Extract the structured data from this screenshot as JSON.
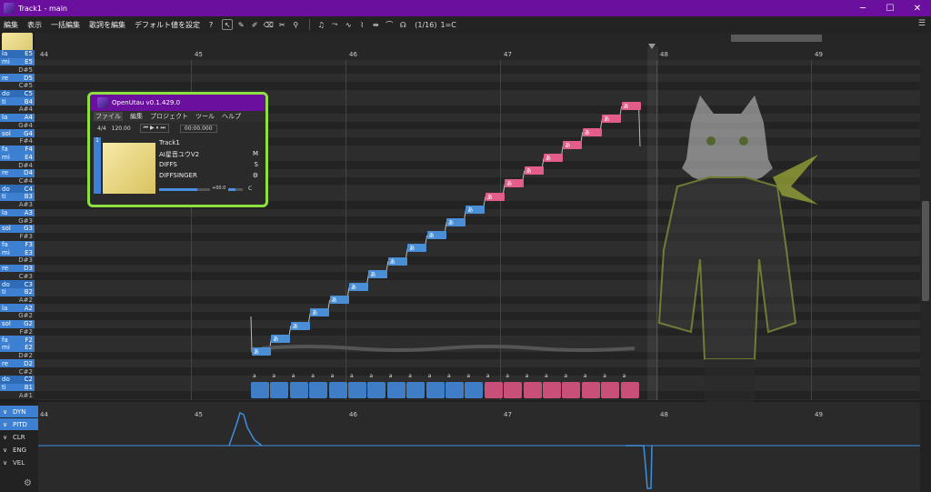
{
  "window": {
    "title": "Track1 - main",
    "minimize": "─",
    "maximize": "☐",
    "close": "✕"
  },
  "menu": [
    "編集",
    "表示",
    "一括編集",
    "歌詞を編集",
    "デフォルト値を設定",
    "?"
  ],
  "toolbar": {
    "tools": [
      "pointer-tool",
      "pen-tool",
      "pen-plus-tool",
      "eraser-tool",
      "knife-tool",
      "brush-tool"
    ],
    "toggles": [
      "note-toggle",
      "pitch-toggle",
      "vibrato-toggle",
      "portamento-toggle",
      "snap-toggle",
      "curve-toggle",
      "voice-toggle"
    ],
    "snap_label": "(1/16)",
    "key_label": "1=C"
  },
  "ruler": {
    "bars": [
      "44",
      "45",
      "46",
      "47",
      "48",
      "49"
    ]
  },
  "piano_keys": [
    {
      "solf": "la",
      "name": "E5",
      "type": "whitealt"
    },
    {
      "solf": "mi",
      "name": "E5",
      "type": "white"
    },
    {
      "solf": "",
      "name": "D#5",
      "type": "black"
    },
    {
      "solf": "re",
      "name": "D5",
      "type": "white"
    },
    {
      "solf": "",
      "name": "C#5",
      "type": "black"
    },
    {
      "solf": "do",
      "name": "C5",
      "type": "whitealt"
    },
    {
      "solf": "ti",
      "name": "B4",
      "type": "white"
    },
    {
      "solf": "",
      "name": "A#4",
      "type": "black"
    },
    {
      "solf": "la",
      "name": "A4",
      "type": "white"
    },
    {
      "solf": "",
      "name": "G#4",
      "type": "black"
    },
    {
      "solf": "sol",
      "name": "G4",
      "type": "white"
    },
    {
      "solf": "",
      "name": "F#4",
      "type": "black"
    },
    {
      "solf": "fa",
      "name": "F4",
      "type": "white"
    },
    {
      "solf": "mi",
      "name": "E4",
      "type": "white"
    },
    {
      "solf": "",
      "name": "D#4",
      "type": "black"
    },
    {
      "solf": "re",
      "name": "D4",
      "type": "white"
    },
    {
      "solf": "",
      "name": "C#4",
      "type": "black"
    },
    {
      "solf": "do",
      "name": "C4",
      "type": "whitealt"
    },
    {
      "solf": "ti",
      "name": "B3",
      "type": "white"
    },
    {
      "solf": "",
      "name": "A#3",
      "type": "black"
    },
    {
      "solf": "la",
      "name": "A3",
      "type": "white"
    },
    {
      "solf": "",
      "name": "G#3",
      "type": "black"
    },
    {
      "solf": "sol",
      "name": "G3",
      "type": "white"
    },
    {
      "solf": "",
      "name": "F#3",
      "type": "black"
    },
    {
      "solf": "fa",
      "name": "F3",
      "type": "white"
    },
    {
      "solf": "mi",
      "name": "E3",
      "type": "white"
    },
    {
      "solf": "",
      "name": "D#3",
      "type": "black"
    },
    {
      "solf": "re",
      "name": "D3",
      "type": "white"
    },
    {
      "solf": "",
      "name": "C#3",
      "type": "black"
    },
    {
      "solf": "do",
      "name": "C3",
      "type": "whitealt"
    },
    {
      "solf": "ti",
      "name": "B2",
      "type": "white"
    },
    {
      "solf": "",
      "name": "A#2",
      "type": "black"
    },
    {
      "solf": "la",
      "name": "A2",
      "type": "white"
    },
    {
      "solf": "",
      "name": "G#2",
      "type": "black"
    },
    {
      "solf": "sol",
      "name": "G2",
      "type": "white"
    },
    {
      "solf": "",
      "name": "F#2",
      "type": "black"
    },
    {
      "solf": "fa",
      "name": "F2",
      "type": "white"
    },
    {
      "solf": "mi",
      "name": "E2",
      "type": "white"
    },
    {
      "solf": "",
      "name": "D#2",
      "type": "black"
    },
    {
      "solf": "re",
      "name": "D2",
      "type": "white"
    },
    {
      "solf": "",
      "name": "C#2",
      "type": "black"
    },
    {
      "solf": "do",
      "name": "C2",
      "type": "whitealt"
    },
    {
      "solf": "ti",
      "name": "B1",
      "type": "white"
    },
    {
      "solf": "",
      "name": "A#1",
      "type": "black"
    }
  ],
  "notes": [
    {
      "lyric": "あ",
      "color": "blue"
    },
    {
      "lyric": "あ",
      "color": "blue"
    },
    {
      "lyric": "あ",
      "color": "blue"
    },
    {
      "lyric": "あ",
      "color": "blue"
    },
    {
      "lyric": "あ",
      "color": "blue"
    },
    {
      "lyric": "あ",
      "color": "blue"
    },
    {
      "lyric": "あ",
      "color": "blue"
    },
    {
      "lyric": "あ",
      "color": "blue"
    },
    {
      "lyric": "あ",
      "color": "blue"
    },
    {
      "lyric": "あ",
      "color": "blue"
    },
    {
      "lyric": "あ",
      "color": "blue"
    },
    {
      "lyric": "あ",
      "color": "blue"
    },
    {
      "lyric": "あ",
      "color": "pink"
    },
    {
      "lyric": "あ",
      "color": "pink"
    },
    {
      "lyric": "あ",
      "color": "pink"
    },
    {
      "lyric": "あ",
      "color": "pink"
    },
    {
      "lyric": "あ",
      "color": "pink"
    },
    {
      "lyric": "あ",
      "color": "pink"
    },
    {
      "lyric": "あ",
      "color": "pink"
    },
    {
      "lyric": "あ",
      "color": "pink"
    }
  ],
  "phoneme_label": "a",
  "float_window": {
    "title": "OpenUtau v0.1.429.0",
    "menu": [
      "ファイル",
      "編集",
      "プロジェクト",
      "ツール",
      "ヘルプ"
    ],
    "time_sig": "4/4",
    "bpm": "120.00",
    "time": "00:00.000",
    "track": {
      "number": "1",
      "name": "Track1",
      "singer": "AI星音ユウV2",
      "phonemizer": "DIFFS",
      "renderer": "DIFFSINGER",
      "mute": "M",
      "solo": "S",
      "volume": "+00.0",
      "pan": "C"
    }
  },
  "expressions": [
    {
      "label": "DYN",
      "state": "on",
      "chev": "∨"
    },
    {
      "label": "PITD",
      "state": "on",
      "chev": "∨"
    },
    {
      "label": "CLR",
      "state": "off",
      "chev": "∨"
    },
    {
      "label": "ENG",
      "state": "off",
      "chev": "∨"
    },
    {
      "label": "VEL",
      "state": "off",
      "chev": "∨"
    }
  ],
  "colors": {
    "titlebar": "#6a0f9e",
    "accent_blue": "#3d7fd1",
    "note_blue": "#4a8fd6",
    "note_pink": "#e35d8a",
    "frame_green": "#8de03f"
  }
}
